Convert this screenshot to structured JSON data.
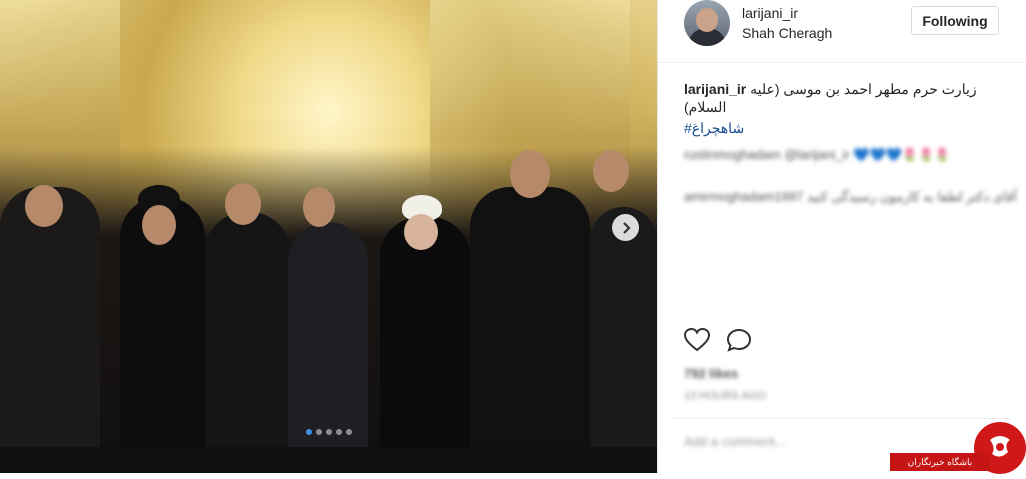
{
  "post": {
    "username": "larijani_ir",
    "location": "Shah Cheragh",
    "follow_label": "Following",
    "caption_user": "larijani_ir",
    "caption_text": "زیارت حرم مطهر احمد بن موسی (علیه السلام)",
    "hashtag": "#شاهچراغ",
    "comments": [
      {
        "user": "rustinmoghadam",
        "text": "@larijani_ir 💙💙💙🌷🌷🌷"
      },
      {
        "user": "amirmoghadam1997",
        "text": "آقای دکتر لطفا به کارمون رسیدگی کنید"
      }
    ],
    "likes": "792 likes",
    "time": "13 HOURS AGO",
    "comment_placeholder": "Add a comment...",
    "carousel_count": 5,
    "carousel_active": 0
  },
  "watermark": {
    "label": "باشگاه خبرنگاران"
  },
  "colors": {
    "accent": "#3b8fe8",
    "hashtag": "#1a4d8f",
    "brand_red": "#d01818"
  }
}
